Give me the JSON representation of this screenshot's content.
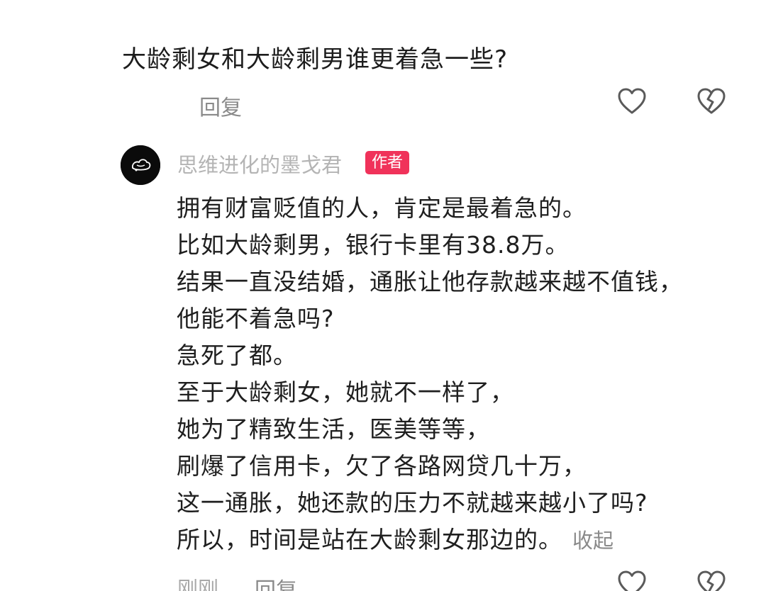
{
  "question": {
    "text": "大龄剩女和大龄剩男谁更着急一些?",
    "reply_label": "回复",
    "like_icon": "heart-outline-icon",
    "dislike_icon": "broken-heart-icon"
  },
  "comment": {
    "username": "思维进化的墨戈君",
    "badge": "作者",
    "avatar_icon": "avatar-logo",
    "lines": [
      "拥有财富贬值的人，肯定是最着急的。",
      "比如大龄剩男，银行卡里有38.8万。",
      "结果一直没结婚，通胀让他存款越来越不值钱，",
      "他能不着急吗?",
      "急死了都。",
      "至于大龄剩女，她就不一样了，",
      "她为了精致生活，医美等等，",
      "刷爆了信用卡，欠了各路网贷几十万，",
      "这一通胀，她还款的压力不就越来越小了吗?",
      "所以，时间是站在大龄剩女那边的。"
    ],
    "collapse_label": "收起",
    "timestamp": "刚刚",
    "reply_label": "回复"
  },
  "colors": {
    "badge": "#f0325a",
    "muted_text": "#8a8a8a",
    "username": "#b4b4b4",
    "icon_stroke": "#5a5a5a"
  }
}
